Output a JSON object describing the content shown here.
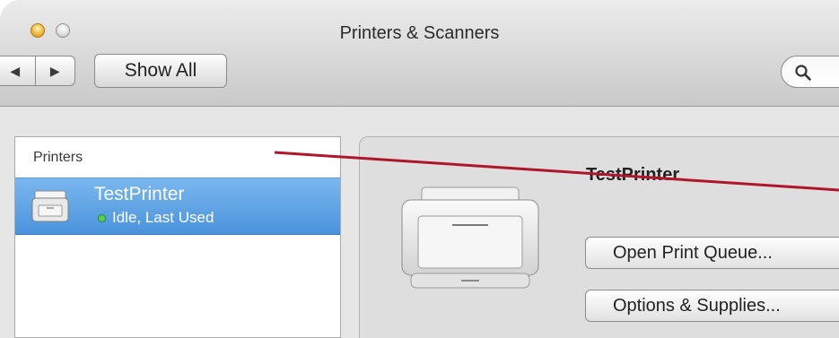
{
  "window": {
    "title": "Printers & Scanners"
  },
  "toolbar": {
    "back_glyph": "◀",
    "forward_glyph": "▶",
    "show_all_label": "Show All"
  },
  "sidebar": {
    "header": "Printers",
    "items": [
      {
        "name": "TestPrinter",
        "status": "Idle, Last Used",
        "selected": true
      }
    ]
  },
  "detail": {
    "printer_name": "TestPrinter",
    "open_queue_label": "Open Print Queue...",
    "options_label": "Options & Supplies..."
  },
  "colors": {
    "selection": "#4a93dc",
    "status_idle": "#57d14c",
    "annotation": "#b0162b"
  },
  "icons": [
    "search-icon",
    "printer-icon",
    "status-dot-icon"
  ]
}
